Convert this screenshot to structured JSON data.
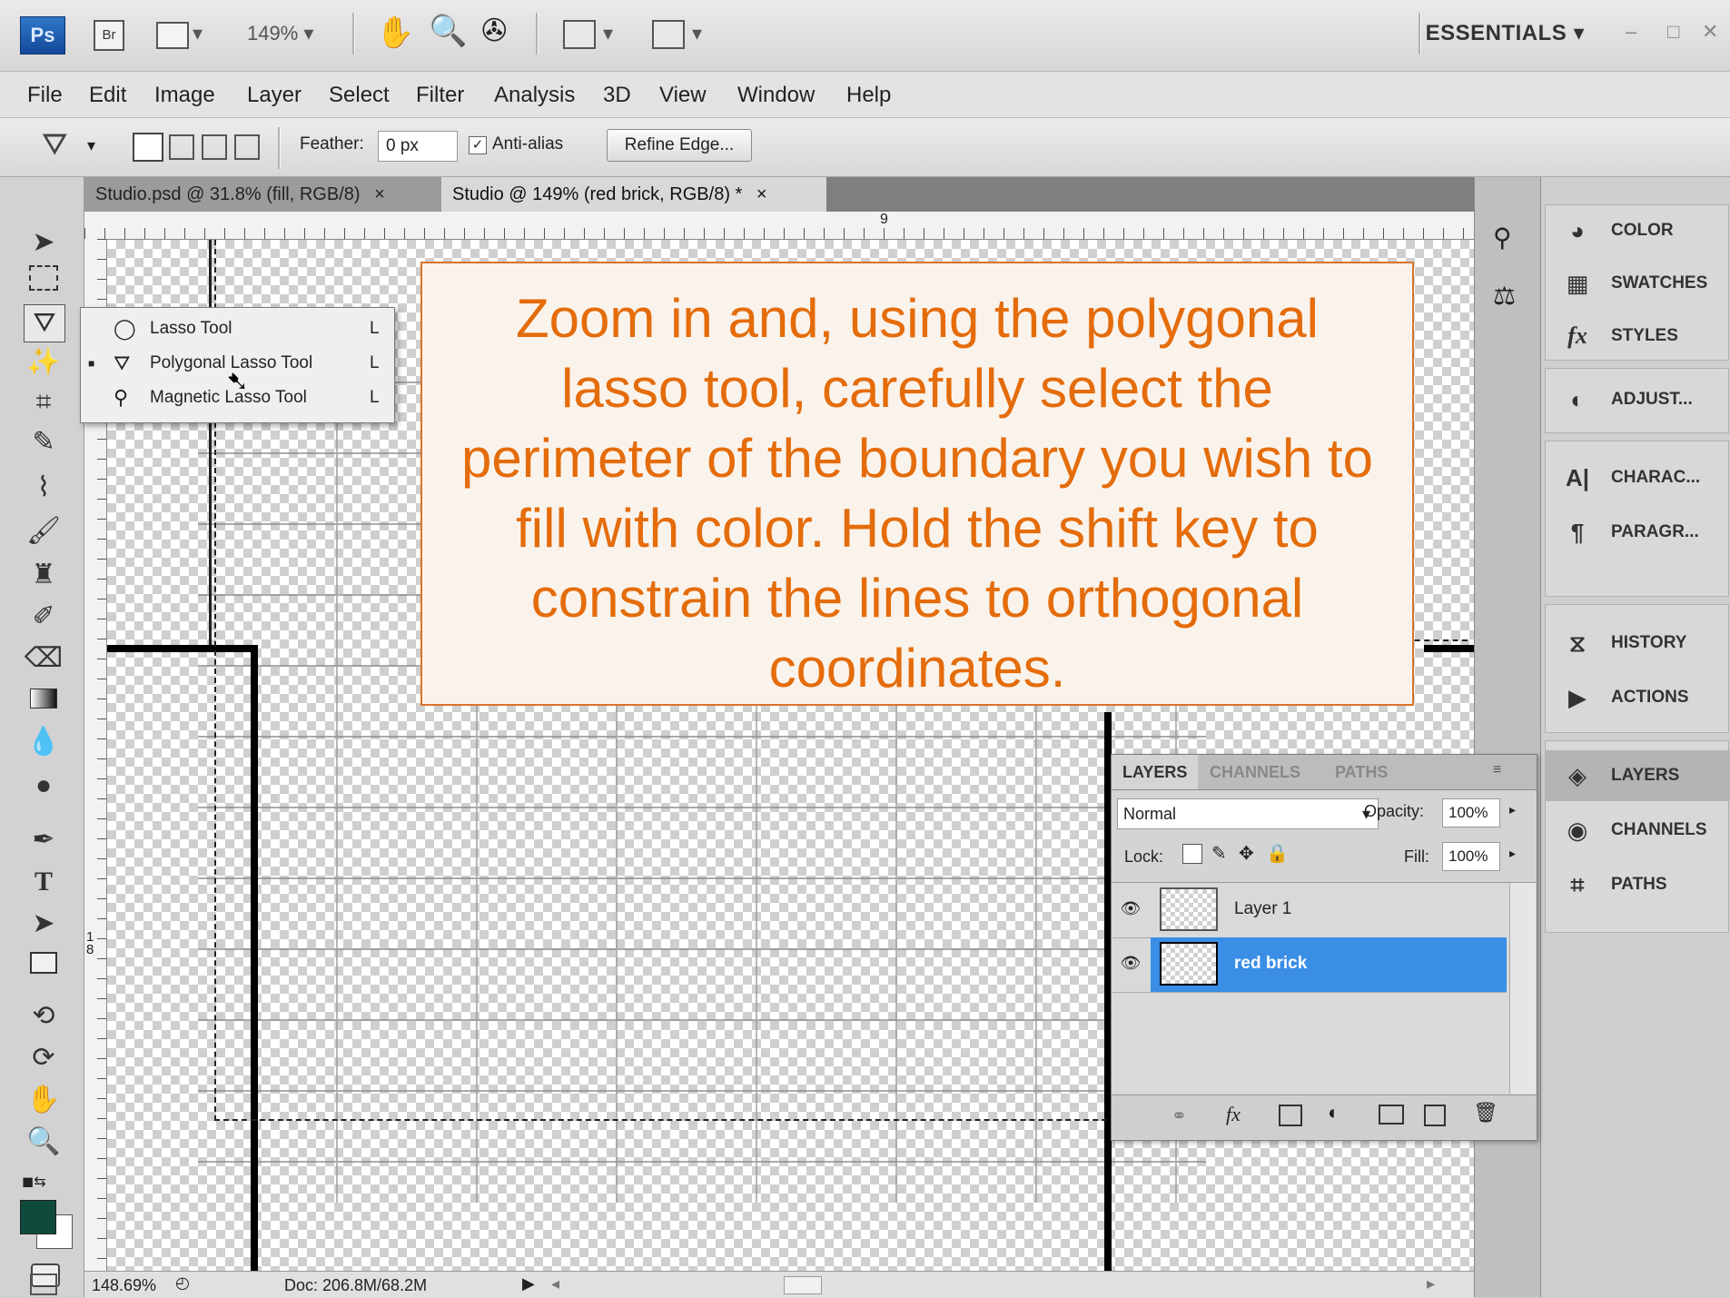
{
  "appbar": {
    "ps": "Ps",
    "br": "Br",
    "zoom": "149% ▾",
    "workspace": "ESSENTIALS ▾",
    "window_controls": [
      "–",
      "□",
      "✕"
    ]
  },
  "menu": [
    "File",
    "Edit",
    "Image",
    "Layer",
    "Select",
    "Filter",
    "Analysis",
    "3D",
    "View",
    "Window",
    "Help"
  ],
  "options": {
    "feather_label": "Feather:",
    "feather_value": "0 px",
    "antialias_label": "Anti-alias",
    "antialias_checked": true,
    "refine_edge": "Refine Edge..."
  },
  "tabs": [
    {
      "label": "Studio.psd @ 31.8% (fill, RGB/8)",
      "close": "×",
      "active": false
    },
    {
      "label": "Studio @ 149% (red brick, RGB/8) *",
      "close": "×",
      "active": true
    }
  ],
  "flyout": [
    {
      "label": "Lasso Tool",
      "key": "L",
      "selected": false,
      "icon": "lasso-icon"
    },
    {
      "label": "Polygonal Lasso Tool",
      "key": "L",
      "selected": true,
      "icon": "polygonal-lasso-icon"
    },
    {
      "label": "Magnetic Lasso Tool",
      "key": "L",
      "selected": false,
      "icon": "magnetic-lasso-icon"
    }
  ],
  "ruler": {
    "top_mark": "9",
    "left_mark": "1\n8"
  },
  "callout": {
    "text": "Zoom in and, using the polygonal lasso tool, carefully select the perimeter of the boundary you wish to fill with color. Hold the shift key to constrain the lines to orthogonal coordinates.",
    "color": "#e46c0a"
  },
  "status": {
    "zoom": "148.69%",
    "doc": "Doc: 206.8M/68.2M"
  },
  "dock": [
    {
      "label": "COLOR",
      "icon": "color-icon"
    },
    {
      "label": "SWATCHES",
      "icon": "swatches-icon"
    },
    {
      "label": "STYLES",
      "icon": "styles-icon"
    },
    {
      "label": "ADJUST...",
      "icon": "adjustments-icon"
    },
    {
      "label": "CHARAC...",
      "icon": "character-icon"
    },
    {
      "label": "PARAGR...",
      "icon": "paragraph-icon"
    },
    {
      "label": "HISTORY",
      "icon": "history-icon"
    },
    {
      "label": "ACTIONS",
      "icon": "actions-icon"
    },
    {
      "label": "LAYERS",
      "icon": "layers-icon"
    },
    {
      "label": "CHANNELS",
      "icon": "channels-icon"
    },
    {
      "label": "PATHS",
      "icon": "paths-icon"
    }
  ],
  "layers_panel": {
    "tabs": [
      "LAYERS",
      "CHANNELS",
      "PATHS"
    ],
    "blend_mode": "Normal",
    "opacity_label": "Opacity:",
    "opacity": "100%",
    "lock_label": "Lock:",
    "fill_label": "Fill:",
    "fill": "100%",
    "layers": [
      {
        "name": "Layer 1",
        "selected": false
      },
      {
        "name": "red brick",
        "selected": true
      }
    ],
    "selected_color": "#3a8ee6"
  },
  "colors": {
    "foreground": "#0f4a3c",
    "background": "#ffffff",
    "accent": "#e46c0a"
  }
}
